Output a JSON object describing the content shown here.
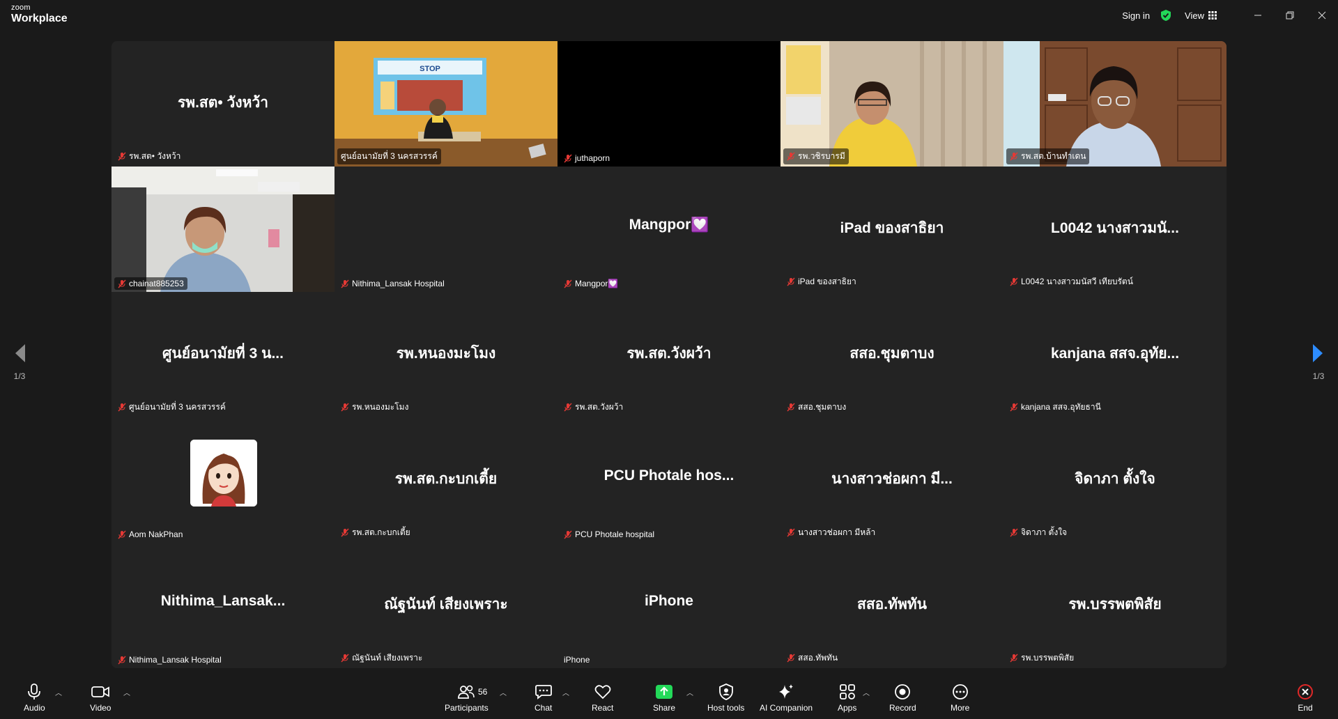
{
  "app": {
    "brand_small": "zoom",
    "brand_large": "Workplace"
  },
  "titlebar": {
    "sign_in": "Sign in",
    "view": "View"
  },
  "pager": {
    "left": "1/3",
    "right": "1/3"
  },
  "tiles": [
    {
      "big": "รพ.สต• วังหว้า",
      "label": "รพ.สต• วังหว้า",
      "muted": true
    },
    {
      "big": "",
      "label": "ศูนย์อนามัยที่ 3 นครสวรรค์",
      "muted": false
    },
    {
      "big": "",
      "label": "juthaporn",
      "muted": true
    },
    {
      "big": "",
      "label": "รพ.วชิรบารมี",
      "muted": true
    },
    {
      "big": "",
      "label": "รพ.สต.บ้านทำเดน",
      "muted": true
    },
    {
      "big": "",
      "label": "chainat885253",
      "muted": true
    },
    {
      "big": "",
      "label": "Nithima_Lansak Hospital",
      "muted": true
    },
    {
      "big": "Mangpor💟",
      "label": "Mangpor💟",
      "muted": true
    },
    {
      "big": "iPad ของสาธิยา",
      "label": "iPad ของสาธิยา",
      "muted": true
    },
    {
      "big": "L0042 นางสาวมนั...",
      "label": "L0042 นางสาวมนัสวี เทียบรัตน์",
      "muted": true
    },
    {
      "big": "ศูนย์อนามัยที่ 3 น...",
      "label": "ศูนย์อนามัยที่ 3 นครสวรรค์",
      "muted": true
    },
    {
      "big": "รพ.หนองมะโมง",
      "label": "รพ.หนองมะโมง",
      "muted": true
    },
    {
      "big": "รพ.สต.วังผว้า",
      "label": "รพ.สต.วังผว้า",
      "muted": true
    },
    {
      "big": "สสอ.ชุมตาบง",
      "label": "สสอ.ชุมตาบง",
      "muted": true
    },
    {
      "big": "kanjana สสจ.อุทัย...",
      "label": "kanjana สสจ.อุทัยธานี",
      "muted": true
    },
    {
      "big": "",
      "label": "Aom NakPhan",
      "muted": true
    },
    {
      "big": "รพ.สต.กะบกเตี้ย",
      "label": "รพ.สต.กะบกเตี้ย",
      "muted": true
    },
    {
      "big": "PCU Photale hos...",
      "label": "PCU Photale hospital",
      "muted": true
    },
    {
      "big": "นางสาวช่อผกา มี...",
      "label": "นางสาวช่อผกา มีหล้า",
      "muted": true
    },
    {
      "big": "จิดาภา ตั้งใจ",
      "label": "จิดาภา ตั้งใจ",
      "muted": true
    },
    {
      "big": "Nithima_Lansak...",
      "label": "Nithima_Lansak Hospital",
      "muted": true
    },
    {
      "big": "ณัฐนันท์ เสียงเพราะ",
      "label": "ณัฐนันท์ เสียงเพราะ",
      "muted": true
    },
    {
      "big": "iPhone",
      "label": "iPhone",
      "muted": false
    },
    {
      "big": "สสอ.ทัพทัน",
      "label": "สสอ.ทัพทัน",
      "muted": true
    },
    {
      "big": "รพ.บรรพตพิสัย",
      "label": "รพ.บรรพตพิสัย",
      "muted": true
    }
  ],
  "toolbar": {
    "audio": "Audio",
    "video": "Video",
    "participants": "Participants",
    "participants_count": "56",
    "chat": "Chat",
    "react": "React",
    "share": "Share",
    "host_tools": "Host tools",
    "ai_companion": "AI Companion",
    "apps": "Apps",
    "record": "Record",
    "more": "More",
    "end": "End"
  },
  "colors": {
    "active_speaker": "#23d959",
    "share_green": "#23d959",
    "end_red": "#e02828"
  }
}
